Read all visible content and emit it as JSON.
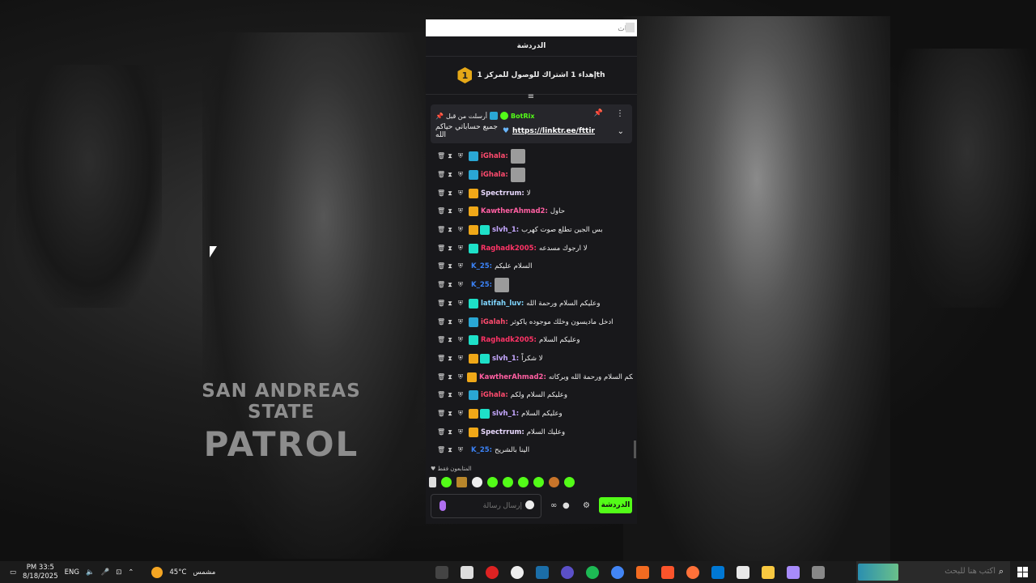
{
  "browser": {
    "url_placeholder": "شات"
  },
  "chat": {
    "header_title": "الدردشة",
    "goal_badge": "1",
    "goal_text": "إهداء 1 اشتراك للوصول للمركز 1th",
    "pinned": {
      "pinned_by": "أرسلت من قبل",
      "bot_name": "BotRix",
      "message": "جميع حساباتي حياكم الله",
      "link": "https://linktr.ee/fttir"
    },
    "messages": [
      {
        "user": "iGhala",
        "color": "#ff4b6e",
        "badges": [
          "blue"
        ],
        "text": "",
        "emote": true
      },
      {
        "user": "iGhala",
        "color": "#ff4b6e",
        "badges": [
          "blue"
        ],
        "text": "",
        "emote": true
      },
      {
        "user": "Spectrrum",
        "color": "#e9d9ff",
        "badges": [
          "crown"
        ],
        "text": "لا"
      },
      {
        "user": "KawtherAhmad2",
        "color": "#ff5fa2",
        "badges": [
          "crown"
        ],
        "text": "حاول"
      },
      {
        "user": "slvh_1",
        "color": "#c6a8ff",
        "badges": [
          "crown",
          "sub"
        ],
        "text": "بس الجين تطلع صوت كهرب"
      },
      {
        "user": "Raghadk2005",
        "color": "#ff3366",
        "badges": [
          "sub"
        ],
        "text": "لا ارجوك مسدعه"
      },
      {
        "user": "K_25",
        "color": "#3b82f6",
        "badges": [],
        "text": "السلام عليكم"
      },
      {
        "user": "K_25",
        "color": "#3b82f6",
        "badges": [],
        "text": "",
        "emote": true
      },
      {
        "user": "latifah_luv",
        "color": "#7fd6ff",
        "badges": [
          "sub"
        ],
        "text": "وعليكم السلام ورحمة الله"
      },
      {
        "user": "iGalah",
        "color": "#ff4b6e",
        "badges": [
          "blue"
        ],
        "text": "ادخل ماديسون وخلك موجوده ياكوثر"
      },
      {
        "user": "Raghadk2005",
        "color": "#ff3366",
        "badges": [
          "sub"
        ],
        "text": "وعليكم السلام"
      },
      {
        "user": "slvh_1",
        "color": "#c6a8ff",
        "badges": [
          "crown",
          "sub"
        ],
        "text": "لا شكراً"
      },
      {
        "user": "KawtherAhmad2",
        "color": "#ff5fa2",
        "badges": [
          "crown"
        ],
        "text": "وعليكم السلام ورحمة الله وبركاته"
      },
      {
        "user": "iGhala",
        "color": "#ff4b6e",
        "badges": [
          "blue"
        ],
        "text": "وعليكم السلام ولكم"
      },
      {
        "user": "slvh_1",
        "color": "#c6a8ff",
        "badges": [
          "crown",
          "sub"
        ],
        "text": "وعليكم السلام"
      },
      {
        "user": "Spectrrum",
        "color": "#e9d9ff",
        "badges": [
          "crown"
        ],
        "text": "وعليك السلام"
      },
      {
        "user": "K_25",
        "color": "#3b82f6",
        "badges": [],
        "text": "الينا بالشريح"
      }
    ],
    "followers_only": "المتابعون فقط",
    "input_placeholder": "إرسال رسالة",
    "send_label": "الدردشة"
  },
  "wallpaper": {
    "patch_line1": "SAN ANDREAS STATE",
    "patch_line2": "PATROL"
  },
  "taskbar": {
    "time": "PM 33:5",
    "date": "8/18/2025",
    "lang": "ENG",
    "weather_temp": "45°C",
    "weather_desc": "مشمس",
    "search_placeholder": "اكتب هنا للبحث"
  },
  "colors": {
    "accent": "#53fc18",
    "panel": "#18181b"
  }
}
